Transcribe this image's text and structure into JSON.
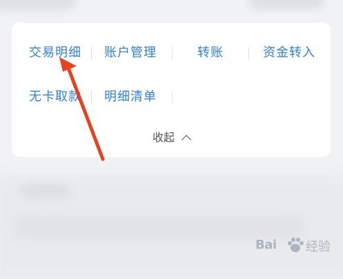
{
  "menu": {
    "row1": [
      "交易明细",
      "账户管理",
      "转账",
      "资金转入"
    ],
    "row2": [
      "无卡取款",
      "明细清单"
    ],
    "collapse_label": "收起"
  },
  "watermark": {
    "brand": "Bai",
    "suffix": "经验"
  },
  "colors": {
    "link": "#2f7fe8",
    "arrow": "#e8411c",
    "card_bg": "#ffffff",
    "page_bg": "#f1f2f4"
  },
  "icons": {
    "collapse": "chevron-up-icon",
    "annotation": "red-arrow-icon",
    "watermark_logo": "paw-icon"
  }
}
